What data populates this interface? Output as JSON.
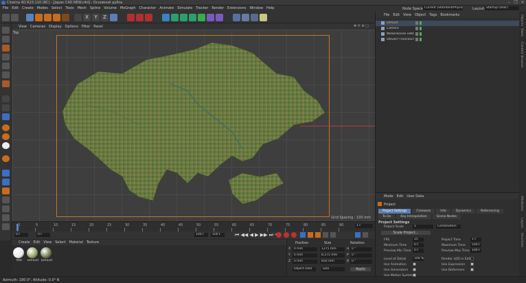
{
  "window": {
    "title": "Cinema 4D R23.110 (RC) - [Japan C4D NEW.c4d] - Основной дубль",
    "controls": [
      "–",
      "❐",
      "✕"
    ]
  },
  "menu": [
    "File",
    "Edit",
    "Create",
    "Modes",
    "Select",
    "Tools",
    "Mesh",
    "Spline",
    "Volume",
    "MoGraph",
    "Character",
    "Animate",
    "Simulate",
    "Tracker",
    "Render",
    "Extensions",
    "Window",
    "Help"
  ],
  "header_right": {
    "node_space_label": "Node Space:",
    "node_space_value": "Current (Standard/Physical)",
    "layout_label": "Layout:",
    "layout_value": "Startup (User)"
  },
  "toolbar": {
    "axis_buttons": [
      "X",
      "Y",
      "Z"
    ]
  },
  "viewport": {
    "menu": [
      "View",
      "Cameras",
      "Display",
      "Options",
      "Filter",
      "Panel"
    ],
    "name": "Top",
    "grid_spacing": "Grid Spacing : 100 mm"
  },
  "timeline": {
    "ticks": [
      "0",
      "5",
      "10",
      "15",
      "20",
      "25",
      "30",
      "35",
      "40",
      "45",
      "50",
      "55",
      "60",
      "65",
      "70",
      "75",
      "80",
      "85",
      "90"
    ],
    "current_frame": "0 F",
    "start_field": "0 F",
    "min_field": "0 F",
    "end_field": "100 F",
    "max_field": "100 F",
    "right_frame": "1 F"
  },
  "materials": {
    "menu": [
      "Create",
      "Edit",
      "View",
      "Select",
      "Material",
      "Texture"
    ],
    "items": [
      {
        "label": "Mat",
        "color": "#e8e8e8"
      },
      {
        "label": "Default",
        "color": "#8fa060"
      },
      {
        "label": "Default",
        "color": "#6a7a4a"
      }
    ]
  },
  "coordinates": {
    "headers": [
      "Position",
      "Size",
      "Rotation"
    ],
    "rows": [
      {
        "axis": "X",
        "position": "0 mm",
        "size": "1275 mm",
        "rot_axis": "H",
        "rotation": "0 °"
      },
      {
        "axis": "Y",
        "position": "0 mm",
        "size": "8.275 mm",
        "rot_axis": "P",
        "rotation": "0 °"
      },
      {
        "axis": "Z",
        "position": "0 mm",
        "size": "850 mm",
        "rot_axis": "B",
        "rotation": "0 °"
      }
    ],
    "mode_select": "Object (Rel)",
    "size_select": "Size",
    "apply": "Apply"
  },
  "status": "Azimuth: 180.0°, Altitude: 0.0° N",
  "object_manager": {
    "menu": [
      "File",
      "Edit",
      "View",
      "Object",
      "Tags",
      "Bookmarks"
    ],
    "objects": [
      {
        "name": "Default",
        "selected": true
      },
      {
        "name": "Camera",
        "selected": false
      },
      {
        "name": "Физическое небо",
        "selected": false
      },
      {
        "name": "Объект Плоскость",
        "selected": false
      }
    ]
  },
  "attributes": {
    "menu": [
      "Mode",
      "Edit",
      "User Data"
    ],
    "title": "Project",
    "tabs_row1": [
      "Project Settings",
      "Cineware",
      "Info",
      "Dynamics",
      "Referencing"
    ],
    "tabs_row2": [
      "To Do",
      "Key Interpolation",
      "Scene Nodes"
    ],
    "section": "Project Settings",
    "project_scale_label": "Project Scale",
    "project_scale_value": "1",
    "project_scale_unit": "Centimeters",
    "scale_button": "Scale Project...",
    "left_fields": [
      {
        "label": "FPS",
        "value": "25"
      },
      {
        "label": "Minimum Time",
        "value": "0 F"
      },
      {
        "label": "Preview Min Time",
        "value": "0 F"
      }
    ],
    "right_fields": [
      {
        "label": "Project Time",
        "value": "1 F"
      },
      {
        "label": "Maximum Time",
        "value": "100 F"
      },
      {
        "label": "Preview Max Time",
        "value": "100 F"
      }
    ],
    "lod_label": "Level of Detail",
    "lod_value": "100 %",
    "render_lod_label": "Render LOD in Editor",
    "checks_left": [
      "Use Animation",
      "Use Generators",
      "Use Motion System"
    ],
    "checks_right": [
      "Use Expression",
      "Use Deformers"
    ]
  },
  "vertical_tabs": [
    "Objects",
    "Takes",
    "Content Browser",
    "Attributes",
    "Layers",
    "Structure"
  ]
}
